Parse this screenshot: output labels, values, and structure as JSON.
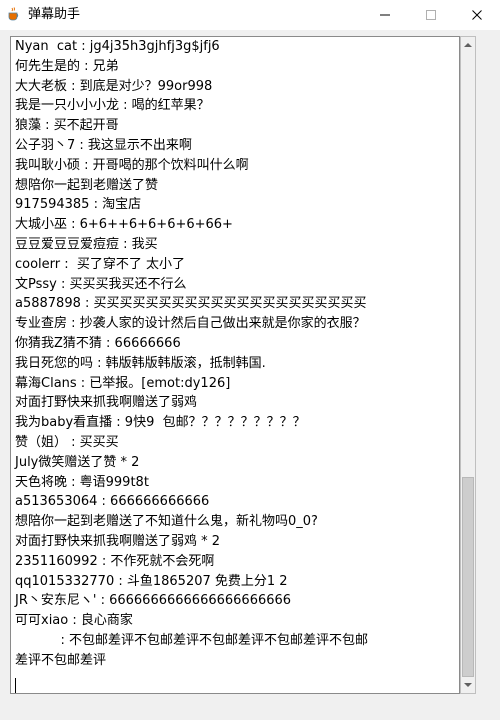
{
  "window": {
    "title": "弹幕助手",
    "app_icon": "java-cup-icon",
    "minimize_icon": "minimize-icon",
    "maximize_icon": "maximize-icon",
    "close_icon": "close-icon"
  },
  "chat": {
    "lines": [
      "Nyan  cat : jg4j35h3gjhfj3g$jfj6",
      "何先生是的 : 兄弟",
      "大大老板 : 到底是对少？99or998",
      "我是一只小小小龙 : 喝的红苹果？",
      "狼藻 : 买不起开哥",
      "公子羽丶7 : 我这显示不出来啊",
      "我叫耿小硕 : 开哥喝的那个饮料叫什么啊",
      "想陪你一起到老赠送了赞",
      "917594385 : 淘宝店",
      "大城小巫 : 6+6++6+6+6+6+66+",
      "豆豆爱豆豆爱痘痘 : 我买",
      "coolerr :  买了穿不了 太小了",
      "文Pssy : 买买买我买还不行么",
      "a5887898 : 买买买买买买买买买买买买买买买买买买买买买",
      "专业查房 : 抄袭人家的设计然后自己做出来就是你家的衣服？",
      "你猜我Z猜不猜 : 66666666",
      "我日死您的吗 : 韩版韩版韩版滚，抵制韩国.",
      "幕海Clans : 已举报。[emot:dy126]",
      "对面打野快来抓我啊赠送了弱鸡",
      "我为baby看直播 : 9快9  包邮？？？？？？？？？",
      "赞（姐） : 买买买",
      "July微笑赠送了赞 * 2",
      "天色将晚 : 粤语999t8t",
      "a513653064 : 666666666666",
      "想陪你一起到老赠送了不知道什么鬼，新礼物吗0_0?",
      "对面打野快来抓我啊赠送了弱鸡 * 2",
      "2351160992 : 不作死就不会死啊",
      "qq1015332770 : 斗鱼1865207 免费上分1 2",
      "JR丶安东尼ヽ' : 6666666666666666666666",
      "可可xiao : 良心商家",
      "           : 不包邮差评不包邮差评不包邮差评不包邮差评不包邮",
      "差评不包邮差评",
      ""
    ]
  },
  "scrollbar": {
    "up_icon": "scroll-up-arrow-icon",
    "down_icon": "scroll-down-arrow-icon",
    "position_fraction": 0.68,
    "visible_fraction": 0.32
  }
}
